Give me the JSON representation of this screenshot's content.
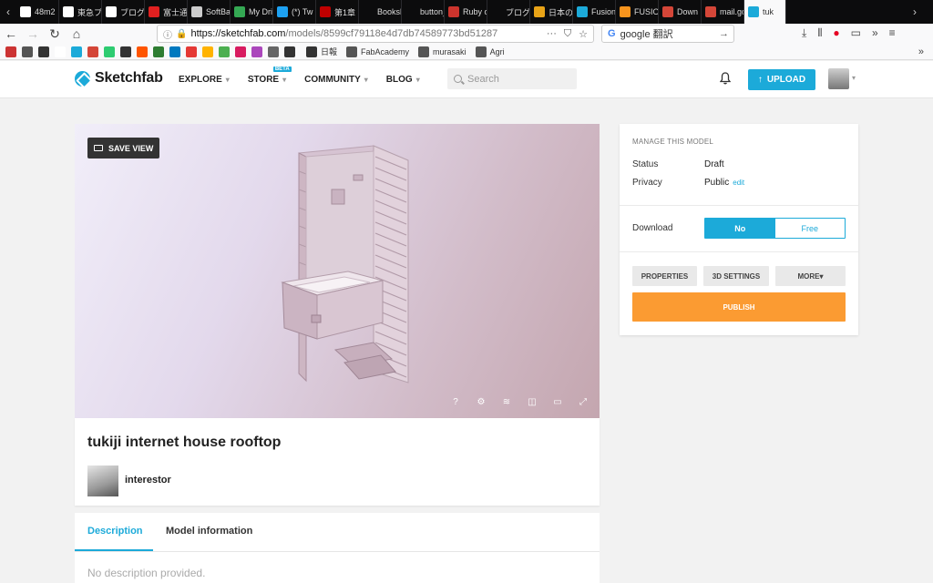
{
  "browser": {
    "tabs": [
      {
        "label": "48m2",
        "color": "#ffffff"
      },
      {
        "label": "東急プ",
        "color": "#ffffff"
      },
      {
        "label": "ブログ",
        "color": "#ffffff"
      },
      {
        "label": "富士通",
        "color": "#e02020"
      },
      {
        "label": "SoftBa",
        "color": "#cccccc"
      },
      {
        "label": "My Dri",
        "color": "#34a853"
      },
      {
        "label": "(*) Tw",
        "color": "#1da1f2"
      },
      {
        "label": "第1章",
        "color": "#c00000"
      },
      {
        "label": "Bookshelf",
        "color": "#0c0c0d"
      },
      {
        "label": "button_to",
        "color": "#0c0c0d"
      },
      {
        "label": "Ruby o",
        "color": "#cc342d"
      },
      {
        "label": "ブログ",
        "color": "#0c0c0d"
      },
      {
        "label": "日本の",
        "color": "#e8a317"
      },
      {
        "label": "Fusion",
        "color": "#1caad9"
      },
      {
        "label": "FUSIO",
        "color": "#f7941d"
      },
      {
        "label": "Down",
        "color": "#d44638"
      },
      {
        "label": "mail.go",
        "color": "#d44638"
      },
      {
        "label": "tuk",
        "color": "#1caad9"
      }
    ],
    "url_host": "https://sketchfab.com",
    "url_path": "/models/8599cf79118e4d7db74589773bd51287",
    "search_value": "google 翻訳",
    "bookmarks": [
      {
        "color": "#cc3333"
      },
      {
        "color": "#555555"
      },
      {
        "color": "#333333"
      },
      {
        "color": "#ffffff"
      },
      {
        "color": "#1caad9"
      },
      {
        "color": "#d44638"
      },
      {
        "color": "#2ecc71"
      },
      {
        "color": "#333333"
      },
      {
        "color": "#ff5500"
      },
      {
        "color": "#2e7d32"
      },
      {
        "color": "#0079bf"
      },
      {
        "color": "#e53935"
      },
      {
        "color": "#ffb300"
      },
      {
        "color": "#4caf50"
      },
      {
        "color": "#d81b60"
      },
      {
        "color": "#ab47bc"
      },
      {
        "color": "#666666"
      },
      {
        "color": "#333333"
      }
    ],
    "bookmark_labels": [
      {
        "label": "日報",
        "color": "#333333"
      },
      {
        "label": "FabAcademy",
        "color": "#555555"
      },
      {
        "label": "murasaki",
        "color": "#555555"
      },
      {
        "label": "Agri",
        "color": "#555555"
      }
    ]
  },
  "header": {
    "logo": "Sketchfab",
    "nav": [
      {
        "label": "EXPLORE"
      },
      {
        "label": "STORE",
        "badge": "BETA"
      },
      {
        "label": "COMMUNITY"
      },
      {
        "label": "BLOG"
      }
    ],
    "search_placeholder": "Search",
    "upload_label": "UPLOAD"
  },
  "viewer": {
    "save_view_label": "SAVE VIEW",
    "help_glyph": "?"
  },
  "model": {
    "title": "tukiji internet house rooftop",
    "author": "interestor"
  },
  "description": {
    "tabs": [
      "Description",
      "Model information"
    ],
    "text": "No description provided."
  },
  "manage": {
    "heading": "MANAGE THIS MODEL",
    "status_label": "Status",
    "status_value": "Draft",
    "privacy_label": "Privacy",
    "privacy_value": "Public",
    "edit_label": "edit",
    "download_label": "Download",
    "download_options": [
      "No",
      "Free"
    ],
    "buttons": [
      "PROPERTIES",
      "3D SETTINGS",
      "MORE▾"
    ],
    "publish_label": "PUBLISH"
  },
  "colors": {
    "accent": "#1caad9",
    "publish": "#fb9b32"
  }
}
